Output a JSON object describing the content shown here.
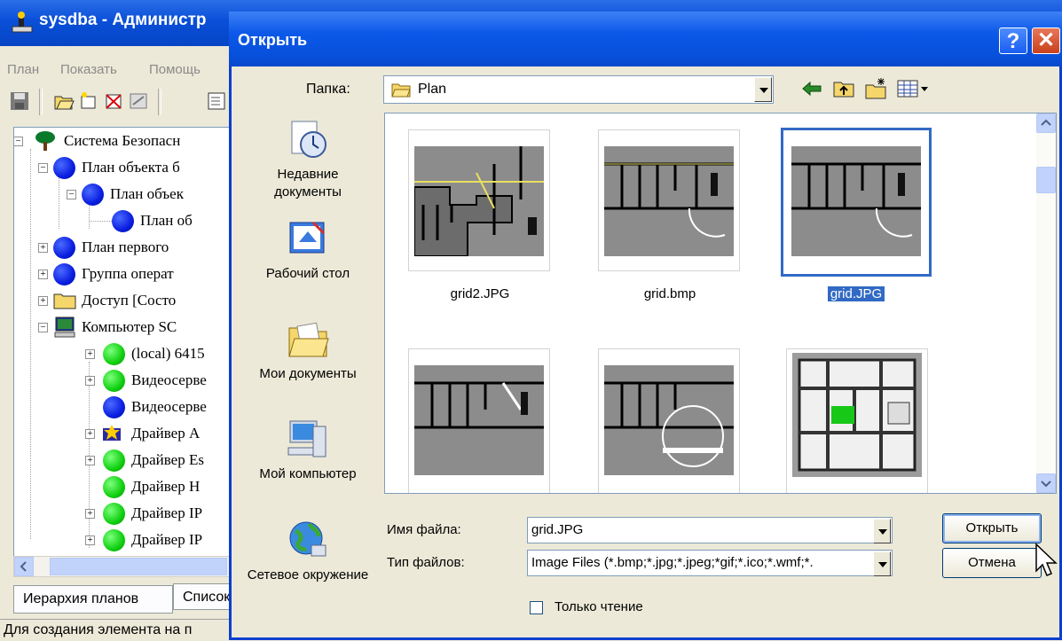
{
  "background_window": {
    "title": "sysdba - Администр",
    "menu": [
      "План",
      "Показать",
      "Помощь"
    ],
    "tree": [
      {
        "label": "Система Безопасн",
        "icon": "tree-icon",
        "expander": "−"
      },
      {
        "label": "План объекта б",
        "icon": "blue-circle",
        "expander": "−"
      },
      {
        "label": "План объек",
        "icon": "blue-circle",
        "expander": "−"
      },
      {
        "label": "План об",
        "icon": "blue-circle",
        "expander": ""
      },
      {
        "label": "План первого ",
        "icon": "blue-circle",
        "expander": "+"
      },
      {
        "label": "Группа операт",
        "icon": "blue-circle",
        "expander": "+"
      },
      {
        "label": "Доступ [Состо",
        "icon": "folder-icon",
        "expander": "+"
      },
      {
        "label": "Компьютер SC",
        "icon": "computer-icon",
        "expander": "−"
      },
      {
        "label": "(local) 6415",
        "icon": "green-circle",
        "expander": "+"
      },
      {
        "label": "Видеосерве",
        "icon": "green-circle",
        "expander": "+"
      },
      {
        "label": "Видеосерве",
        "icon": "blue-circle",
        "expander": ""
      },
      {
        "label": "Драйвер A",
        "icon": "driver-icon",
        "expander": "+"
      },
      {
        "label": "Драйвер Es",
        "icon": "green-circle",
        "expander": "+"
      },
      {
        "label": "Драйвер H",
        "icon": "green-circle",
        "expander": ""
      },
      {
        "label": "Драйвер IP",
        "icon": "green-circle",
        "expander": "+"
      },
      {
        "label": "Драйвер IP",
        "icon": "green-circle",
        "expander": "+"
      }
    ],
    "tabs": [
      "Иерархия планов",
      "Список"
    ],
    "status": "Для создания элемента на п"
  },
  "dialog": {
    "title": "Открыть",
    "help": "?",
    "close": "✕",
    "look_in_label": "Папка:",
    "look_in_value": "Plan",
    "places": [
      "Недавние документы",
      "Рабочий стол",
      "Мои документы",
      "Мой компьютер",
      "Сетевое окружение"
    ],
    "files": [
      {
        "name": "grid2.JPG",
        "selected": false
      },
      {
        "name": "grid.bmp",
        "selected": false
      },
      {
        "name": "grid.JPG",
        "selected": true
      },
      {
        "name": "",
        "selected": false
      },
      {
        "name": "",
        "selected": false
      },
      {
        "name": "",
        "selected": false
      }
    ],
    "filename_label": "Имя файла:",
    "filename_value": "grid.JPG",
    "filetype_label": "Тип файлов:",
    "filetype_value": "Image Files (*.bmp;*.jpg;*.jpeg;*gif;*.ico;*.wmf;*.",
    "readonly_label": "Только чтение",
    "open_button": "Открыть",
    "cancel_button": "Отмена"
  },
  "colors": {
    "title_blue": "#0a4fd8",
    "selection": "#316ac5",
    "close_red": "#c8401c"
  }
}
